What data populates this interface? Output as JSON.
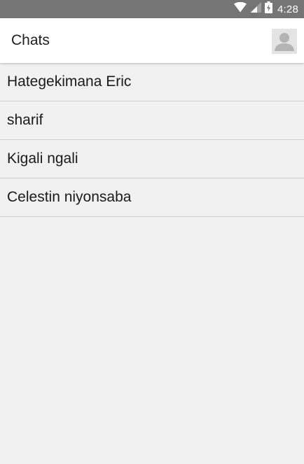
{
  "status_bar": {
    "time": "4:28",
    "icons": [
      "wifi-icon",
      "cell-signal-icon",
      "battery-charging-icon"
    ]
  },
  "toolbar": {
    "title": "Chats",
    "avatar_icon": "default-avatar-icon"
  },
  "chats": [
    {
      "name": "Hategekimana Eric"
    },
    {
      "name": "sharif"
    },
    {
      "name": "Kigali ngali"
    },
    {
      "name": "Celestin niyonsaba"
    }
  ],
  "colors": {
    "status_bar": "#757575",
    "toolbar": "#ffffff",
    "background": "#f1f1f1",
    "divider": "#cfcfcf",
    "text": "#1a1a1a"
  }
}
